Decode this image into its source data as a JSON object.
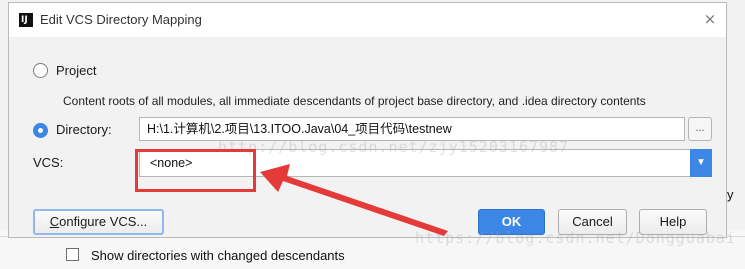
{
  "background": {
    "checkbox_label": "Show directories with changed descendants",
    "clipped_letter": "y"
  },
  "dialog": {
    "title": "Edit VCS Directory Mapping",
    "app_icon": "intellij-icon",
    "close_icon": "×",
    "project_option": {
      "label": "Project",
      "selected": false,
      "description": "Content roots of all modules, all immediate descendants of project base directory, and .idea directory contents"
    },
    "directory_option": {
      "label": "Directory:",
      "selected": true,
      "value": "H:\\1.计算机\\2.项目\\13.ITOO.Java\\04_项目代码\\testnew",
      "browse_label": "..."
    },
    "vcs": {
      "label": "VCS:",
      "value": "<none>",
      "arrow": "▼"
    },
    "buttons": {
      "configure_prefix": "C",
      "configure_rest": "onfigure VCS...",
      "ok": "OK",
      "cancel": "Cancel",
      "help": "Help"
    }
  },
  "watermarks": {
    "top": "http://blog.csdn.net/zjy15203167987",
    "bottom": "https://blog.csdn.net/Dongguabai"
  },
  "annotation": {
    "color": "#e53a3a"
  }
}
